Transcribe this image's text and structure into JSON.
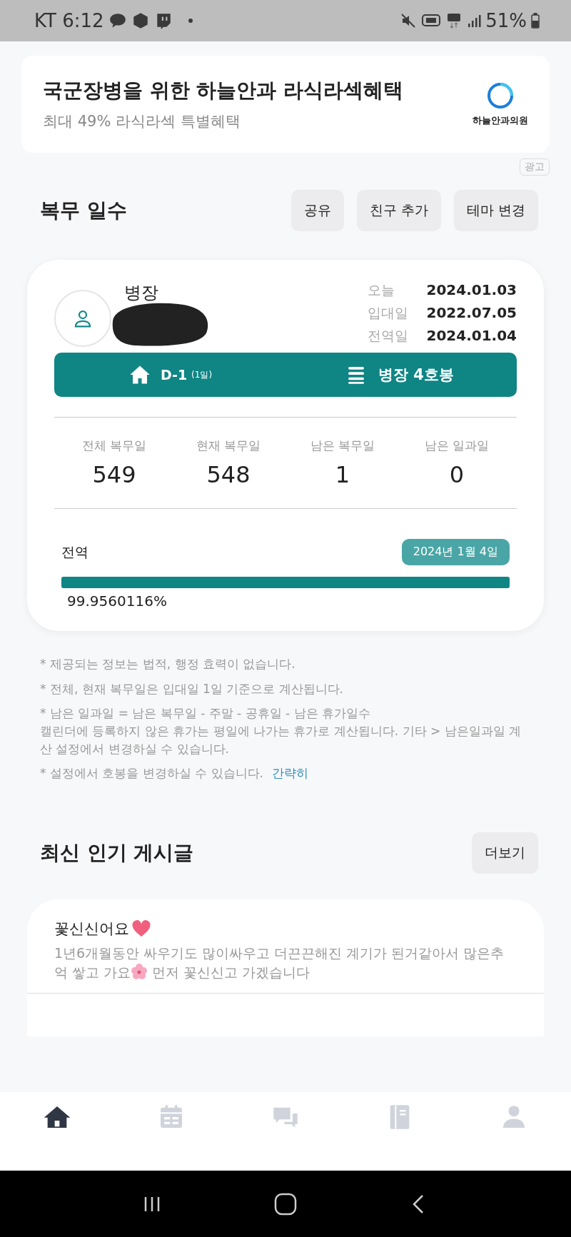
{
  "status_bar": {
    "carrier_time": "KT 6:12",
    "battery": "51%"
  },
  "ad": {
    "title": "국군장병을 위한 하늘안과 라식라섹혜택",
    "subtitle": "최대 49% 라식라섹 특별혜택",
    "brand": "하늘안과의원",
    "badge": "광고"
  },
  "service": {
    "title": "복무 일수",
    "buttons": [
      "공유",
      "친구 추가",
      "테마 변경"
    ],
    "profile": {
      "rank": "병장"
    },
    "dates": [
      {
        "label": "오늘",
        "value": "2024.01.03"
      },
      {
        "label": "입대일",
        "value": "2022.07.05"
      },
      {
        "label": "전역일",
        "value": "2024.01.04"
      }
    ],
    "banner": {
      "dday": "D-1",
      "dday_note": "(1일)",
      "grade": "병장 4호봉"
    },
    "stats": [
      {
        "label": "전체 복무일",
        "value": "549"
      },
      {
        "label": "현재 복무일",
        "value": "548"
      },
      {
        "label": "남은 복무일",
        "value": "1"
      },
      {
        "label": "남은 일과일",
        "value": "0"
      }
    ],
    "progress": {
      "label": "전역",
      "date": "2024년 1월 4일",
      "level": 0.99956,
      "reading": "99.9560116%"
    }
  },
  "notes": [
    "* 제공되는 정보는 법적, 행정 효력이 없습니다.",
    "* 전체, 현재 복무일은 입대일 1일 기준으로 계산됩니다.",
    "* 남은 일과일 = 남은 복무일 - 주말 - 공휴일 - 남은 휴가일수\n캘린더에 등록하지 않은 휴가는 평일에 나가는 휴가로 계산됩니다. 기타 > 남은일과일 계산 설정에서 변경하실 수 있습니다.",
    "* 설정에서 호봉을 변경하실 수 있습니다."
  ],
  "notes_link": "간략히",
  "popular": {
    "title": "최신 인기 게시글",
    "more": "더보기",
    "posts": [
      {
        "title": "꽃신신어요",
        "body_before": "1년6개월동안 싸우기도 많이싸우고 더끈끈해진 계기가 된거같아서 많은추억 쌓고 가요",
        "body_after": " 먼저 꽃신신고 가겠습니다"
      }
    ]
  },
  "bottom_nav": [
    {
      "kind": "home",
      "selected": true
    },
    {
      "kind": "calendar",
      "selected": false
    },
    {
      "kind": "chat",
      "selected": false
    },
    {
      "kind": "notebook",
      "selected": false
    },
    {
      "kind": "profile",
      "selected": false
    }
  ]
}
